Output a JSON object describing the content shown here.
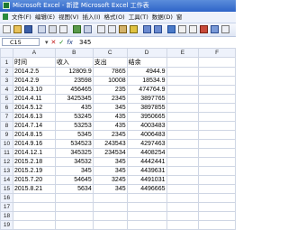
{
  "window": {
    "title": "Microsoft Excel - 新建 Microsoft Excel 工作表"
  },
  "menu": [
    "文件(F)",
    "编辑(E)",
    "视图(V)",
    "插入(I)",
    "格式(O)",
    "工具(T)",
    "数据(D)",
    "窗"
  ],
  "formula_bar": {
    "cell_ref": "C15",
    "value": "345",
    "fx": "fx"
  },
  "columns": [
    "A",
    "B",
    "C",
    "D",
    "E",
    "F"
  ],
  "rows": [
    {
      "n": "1",
      "cells": [
        "时间",
        "收入",
        "支出",
        "结余",
        "",
        ""
      ]
    },
    {
      "n": "2",
      "cells": [
        "2014.2.5",
        "12809.9",
        "7865",
        "4944.9",
        "",
        ""
      ]
    },
    {
      "n": "3",
      "cells": [
        "2014.2.9",
        "23598",
        "10008",
        "18534.9",
        "",
        ""
      ]
    },
    {
      "n": "4",
      "cells": [
        "2014.3.10",
        "456465",
        "235",
        "474764.9",
        "",
        ""
      ]
    },
    {
      "n": "5",
      "cells": [
        "2014.4.11",
        "3425345",
        "2345",
        "3897765",
        "",
        ""
      ]
    },
    {
      "n": "6",
      "cells": [
        "2014.5.12",
        "435",
        "345",
        "3897855",
        "",
        ""
      ]
    },
    {
      "n": "7",
      "cells": [
        "2014.6.13",
        "53245",
        "435",
        "3950665",
        "",
        ""
      ]
    },
    {
      "n": "8",
      "cells": [
        "2014.7.14",
        "53253",
        "435",
        "4003483",
        "",
        ""
      ]
    },
    {
      "n": "9",
      "cells": [
        "2014.8.15",
        "5345",
        "2345",
        "4006483",
        "",
        ""
      ]
    },
    {
      "n": "10",
      "cells": [
        "2014.9.16",
        "534523",
        "243543",
        "4297463",
        "",
        ""
      ]
    },
    {
      "n": "11",
      "cells": [
        "2014.12.1",
        "345325",
        "234534",
        "4408254",
        "",
        ""
      ]
    },
    {
      "n": "12",
      "cells": [
        "2015.2.18",
        "34532",
        "345",
        "4442441",
        "",
        ""
      ]
    },
    {
      "n": "13",
      "cells": [
        "2015.2.19",
        "345",
        "345",
        "4439631",
        "",
        ""
      ]
    },
    {
      "n": "14",
      "cells": [
        "2015.7.20",
        "54645",
        "3245",
        "4491031",
        "",
        ""
      ]
    },
    {
      "n": "15",
      "cells": [
        "2015.8.21",
        "5634",
        "345",
        "4496665",
        "",
        ""
      ]
    },
    {
      "n": "16",
      "cells": [
        "",
        "",
        "",
        "",
        "",
        ""
      ]
    },
    {
      "n": "17",
      "cells": [
        "",
        "",
        "",
        "",
        "",
        ""
      ]
    },
    {
      "n": "18",
      "cells": [
        "",
        "",
        "",
        "",
        "",
        ""
      ]
    },
    {
      "n": "19",
      "cells": [
        "",
        "",
        "",
        "",
        "",
        ""
      ]
    }
  ]
}
